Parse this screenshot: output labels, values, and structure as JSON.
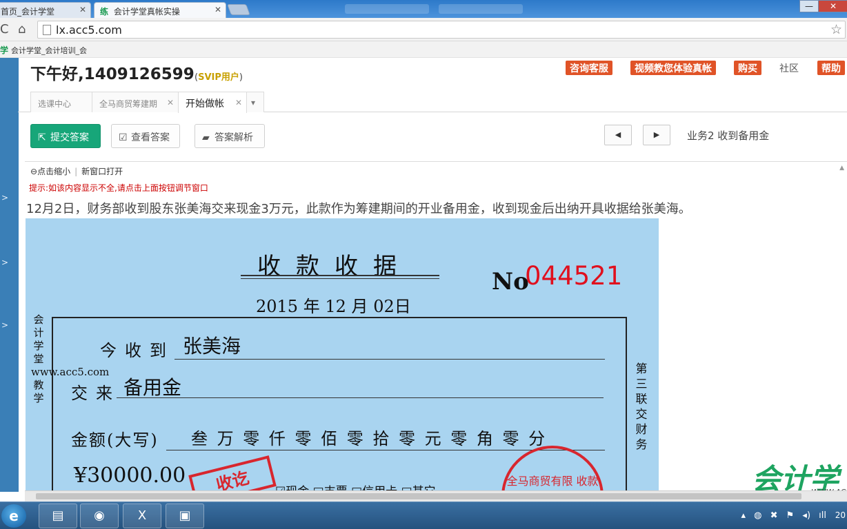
{
  "browser": {
    "tabs": [
      {
        "label": "首页_会计学堂"
      },
      {
        "label": "会计学堂真帐实操",
        "icon": "练"
      }
    ],
    "url": "lx.acc5.com",
    "bookmark": {
      "icon": "学",
      "label": "会计学堂_会计培训_会"
    },
    "window_controls": {
      "minimize": "—",
      "close": "✕"
    }
  },
  "header": {
    "greeting": "下午好,1409126599",
    "svip_open": "(",
    "svip": "SVIP用户",
    "svip_close": ")",
    "buttons": [
      {
        "label": "咨询客服"
      },
      {
        "label": "视频教您体验真帐"
      },
      {
        "label": "购买"
      },
      {
        "label": "社区"
      },
      {
        "label": "帮助"
      }
    ]
  },
  "page_tabs": [
    {
      "label": "选课中心"
    },
    {
      "label": "全马商贸筹建期"
    },
    {
      "label": "开始做帐"
    }
  ],
  "toolbar": {
    "submit": "提交答案",
    "view": "查看答案",
    "analysis": "答案解析",
    "business": "业务2  收到备用金"
  },
  "content": {
    "zoom": "点击缩小",
    "new_window": "新窗口打开",
    "hint_prefix": "提示:",
    "hint": "如该内容显示不全,请点击上面按钮调节窗口",
    "description": "12月2日，财务部收到股东张美海交来现金3万元，此款作为筹建期间的开业备用金，收到现金后出纳开具收据给张美海。"
  },
  "receipt": {
    "title": "收款收据",
    "no_label": "No",
    "number": "044521",
    "date_year": "2015",
    "year_char": "年",
    "date_month": "12",
    "month_char": "月",
    "date_day": "02",
    "day_char": "日",
    "received_from_label": "今收到",
    "received_from": "张美海",
    "for_label": "交来",
    "for_value": "备用金",
    "amount_label": "金额(大写)",
    "amount_words": "叁 万  零 仟  零 佰  零 拾  零 元  零 角  零 分",
    "amount_figure": "¥30000.00",
    "payment_methods": "☑现金  □支票  □信用卡  □其它",
    "left_side_text": "会计学堂www.acc5.com教学",
    "right_side_text": "第三联 交财务",
    "stamp_text": "收讫",
    "round_stamp_text": "全马商贸有限 收款(盖章)"
  },
  "watermark": {
    "main": "会计学",
    "sub": "WWW.AC"
  },
  "taskbar": {
    "clock": "20"
  }
}
